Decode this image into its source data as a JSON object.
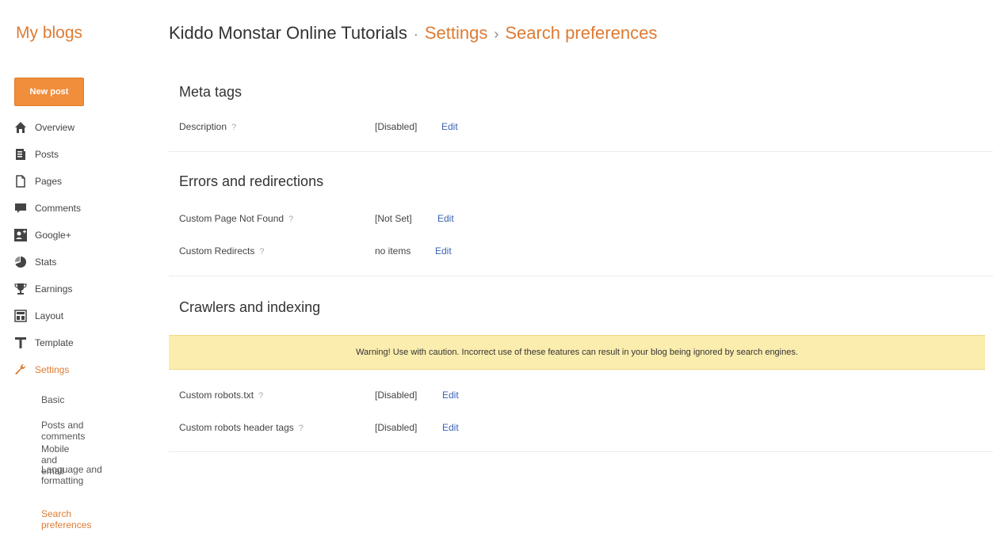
{
  "header": {
    "my_blogs": "My blogs",
    "blog_name": "Kiddo Monstar Online Tutorials",
    "sep1": "·",
    "settings": "Settings",
    "sep2": "›",
    "current": "Search preferences"
  },
  "sidebar": {
    "new_post": "New post",
    "items": [
      {
        "label": "Overview",
        "icon": "home-icon"
      },
      {
        "label": "Posts",
        "icon": "posts-icon"
      },
      {
        "label": "Pages",
        "icon": "pages-icon"
      },
      {
        "label": "Comments",
        "icon": "comments-icon"
      },
      {
        "label": "Google+",
        "icon": "google-plus-icon"
      },
      {
        "label": "Stats",
        "icon": "stats-icon"
      },
      {
        "label": "Earnings",
        "icon": "trophy-icon"
      },
      {
        "label": "Layout",
        "icon": "layout-icon"
      },
      {
        "label": "Template",
        "icon": "template-icon"
      },
      {
        "label": "Settings",
        "icon": "wrench-icon"
      }
    ],
    "sub_items": [
      {
        "label": "Basic"
      },
      {
        "label": "Posts and comments"
      },
      {
        "label": "Mobile and email"
      },
      {
        "label": "Language and formatting"
      },
      {
        "label": "Search preferences"
      }
    ]
  },
  "main": {
    "meta_tags": {
      "title": "Meta tags",
      "description": {
        "label": "Description",
        "help": "?",
        "value": "[Disabled]",
        "edit": "Edit"
      }
    },
    "errors": {
      "title": "Errors and redirections",
      "not_found": {
        "label": "Custom Page Not Found",
        "help": "?",
        "value": "[Not Set]",
        "edit": "Edit"
      },
      "redirects": {
        "label": "Custom Redirects",
        "help": "?",
        "value": "no items",
        "edit": "Edit"
      }
    },
    "crawlers": {
      "title": "Crawlers and indexing",
      "warning": "Warning! Use with caution. Incorrect use of these features can result in your blog being ignored by search engines.",
      "robots_txt": {
        "label": "Custom robots.txt",
        "help": "?",
        "value": "[Disabled]",
        "edit": "Edit"
      },
      "robots_header": {
        "label": "Custom robots header tags",
        "help": "?",
        "value": "[Disabled]",
        "edit": "Edit"
      }
    }
  },
  "colors": {
    "accent": "#dd7b33",
    "link": "#3b62b5",
    "warning_bg": "#fbedae",
    "button": "#f08e3c"
  }
}
